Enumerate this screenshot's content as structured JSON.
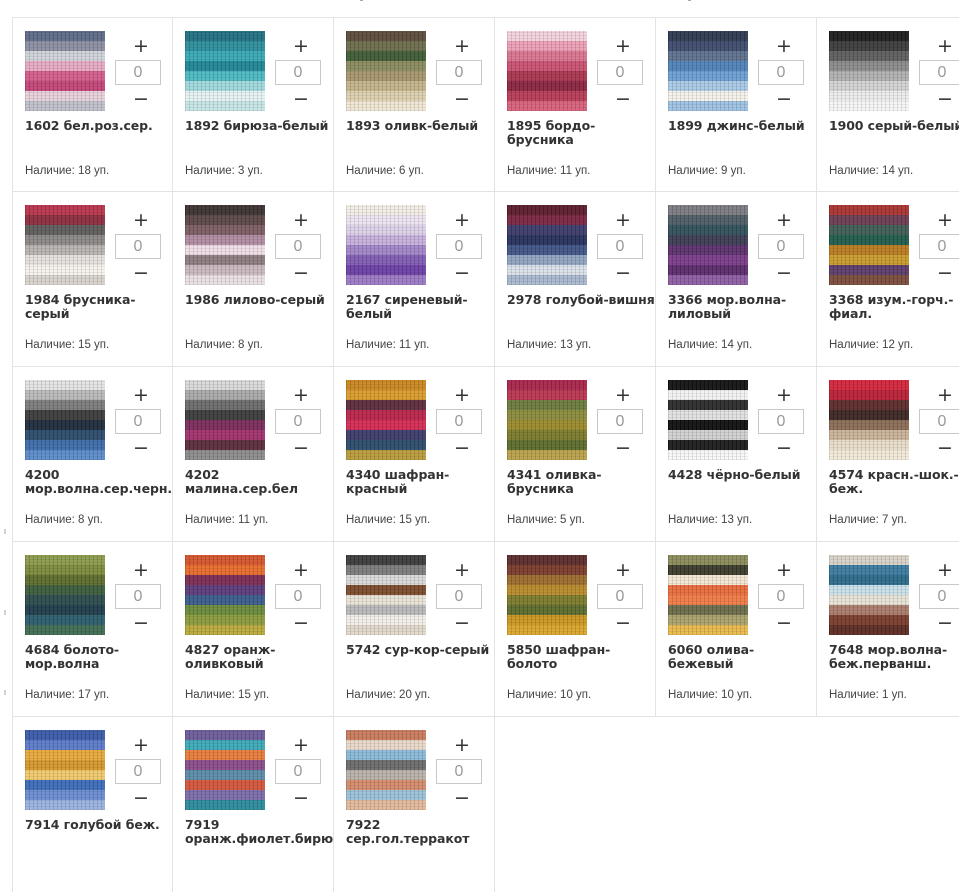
{
  "stock_prefix": "Наличие:",
  "stock_unit": "уп.",
  "controls": {
    "plus": "+",
    "minus": "−"
  },
  "products": [
    {
      "name": "1602 бел.роз.сер.",
      "qty": "0",
      "stock": 18,
      "colors": [
        "#5c6a85",
        "#8a8ea0",
        "#cfd2da",
        "#e6a9c3",
        "#d15a8a",
        "#c24478",
        "#e8cfd9",
        "#bdbec8"
      ]
    },
    {
      "name": "1892 бирюза-белый",
      "qty": "0",
      "stock": 3,
      "colors": [
        "#1f6f82",
        "#2a8d9c",
        "#36a8b4",
        "#1e8595",
        "#4bb8c2",
        "#9fd8dc",
        "#e6f2f2",
        "#c6e4e6"
      ]
    },
    {
      "name": "1893 оливк-белый",
      "qty": "0",
      "stock": 6,
      "colors": [
        "#5a4a3a",
        "#6a6b4a",
        "#3e5a33",
        "#8a8a5e",
        "#a5956b",
        "#c4b38a",
        "#dccfae",
        "#efe6d3"
      ]
    },
    {
      "name": "1895 бордо-брусника",
      "qty": "0",
      "stock": 11,
      "colors": [
        "#f2d2dc",
        "#ec9db4",
        "#d9728e",
        "#c9506f",
        "#a8344f",
        "#8a2440",
        "#b73a55",
        "#d75f7b"
      ]
    },
    {
      "name": "1899 джинс-белый",
      "qty": "0",
      "stock": 9,
      "colors": [
        "#2d3850",
        "#3c4a6a",
        "#5d6f8d",
        "#4f82b8",
        "#6b9ed1",
        "#a9c8e6",
        "#f4f2ea",
        "#9ec0e2"
      ]
    },
    {
      "name": "1900 серый-белый",
      "qty": "0",
      "stock": 14,
      "colors": [
        "#1c1c1c",
        "#3a3a3a",
        "#5c5c5c",
        "#8a8a8a",
        "#b0b0b0",
        "#d2d2d2",
        "#ececec",
        "#f6f6f6"
      ]
    },
    {
      "name": "1984 брусника-серый",
      "qty": "0",
      "stock": 15,
      "colors": [
        "#b8334c",
        "#8c2b3d",
        "#5e5a5a",
        "#8a8686",
        "#b8b3b0",
        "#e4e0dc",
        "#f5f2ee",
        "#d8d2cc"
      ]
    },
    {
      "name": "1986 лилово-серый",
      "qty": "0",
      "stock": 8,
      "colors": [
        "#3a3030",
        "#5a4545",
        "#7a5a62",
        "#b08aa0",
        "#f0dde6",
        "#8c7a7e",
        "#c9b8bd",
        "#e9dfe2"
      ]
    },
    {
      "name": "2167 сиреневый-белый",
      "qty": "0",
      "stock": 11,
      "colors": [
        "#f2eee6",
        "#ece3ef",
        "#ddd0e8",
        "#c6b0dc",
        "#a184c8",
        "#7f5bb2",
        "#6a3ea4",
        "#9a78c4"
      ]
    },
    {
      "name": "2978 голубой-вишня",
      "qty": "0",
      "stock": 13,
      "colors": [
        "#5a1a2a",
        "#7a2440",
        "#3a3a6a",
        "#26305a",
        "#3e5484",
        "#8fa2c0",
        "#d9e0e8",
        "#a7b7cc"
      ]
    },
    {
      "name": "3366 мор.волна-лиловый",
      "qty": "0",
      "stock": 14,
      "colors": [
        "#7a7a82",
        "#4e5a64",
        "#2e4f58",
        "#3a3a52",
        "#5a2f6a",
        "#7a3a8a",
        "#5a2a6a",
        "#8c5aa2"
      ]
    },
    {
      "name": "3368 изум.-горч.-фиал.",
      "qty": "0",
      "stock": 12,
      "colors": [
        "#a8322f",
        "#6a3a52",
        "#3e5a52",
        "#1e5a4a",
        "#b87a1e",
        "#c9992a",
        "#5a3a6a",
        "#7a4a3a"
      ]
    },
    {
      "name": "4200 мор.волна.сер.черн.",
      "qty": "0",
      "stock": 8,
      "colors": [
        "#e2e2e2",
        "#b8b8b8",
        "#7a7a7a",
        "#3a3a3a",
        "#1e2a3a",
        "#2a4a6a",
        "#3a6aa8",
        "#5a8ac8"
      ]
    },
    {
      "name": "4202 малина.сер.бел",
      "qty": "0",
      "stock": 11,
      "colors": [
        "#d8d8d8",
        "#a8a8a8",
        "#6a6a6a",
        "#3a3a3a",
        "#7a2a5a",
        "#a0306a",
        "#5a2a3a",
        "#8a8a8a"
      ]
    },
    {
      "name": "4340 шафран-красный",
      "qty": "0",
      "stock": 15,
      "colors": [
        "#c9851e",
        "#d99a2a",
        "#5a2a3a",
        "#b8234a",
        "#d42a52",
        "#3a3a6a",
        "#2a4a6a",
        "#b89a3a"
      ]
    },
    {
      "name": "4341 оливка-брусника",
      "qty": "0",
      "stock": 5,
      "colors": [
        "#a8234a",
        "#b8344e",
        "#6a7a3a",
        "#8a8a3a",
        "#9a8a2a",
        "#7a7a2a",
        "#5a6a2a",
        "#b8a04a"
      ]
    },
    {
      "name": "4428 чёрно-белый",
      "qty": "0",
      "stock": 13,
      "colors": [
        "#111111",
        "#f2f2f2",
        "#2a2a2a",
        "#e0e0e0",
        "#0e0e0e",
        "#cfcfcf",
        "#1a1a1a",
        "#f8f8f8"
      ]
    },
    {
      "name": "4574 красн.-шок.-беж.",
      "qty": "0",
      "stock": 7,
      "colors": [
        "#d4233a",
        "#b81e34",
        "#5a2a2a",
        "#3a2420",
        "#8a6a55",
        "#c8b298",
        "#e8dcc8",
        "#f2ead8"
      ]
    },
    {
      "name": "4684 болото-мор.волна",
      "qty": "0",
      "stock": 17,
      "colors": [
        "#8a9a4a",
        "#7a8a3a",
        "#5a6a2a",
        "#3a5a3a",
        "#2a4a4a",
        "#1e3a4a",
        "#2a5a6a",
        "#3e6a52"
      ]
    },
    {
      "name": "4827 оранж-оливковый",
      "qty": "0",
      "stock": 15,
      "colors": [
        "#d4542a",
        "#e86a2a",
        "#7a2a52",
        "#5a3a7a",
        "#3a5a8a",
        "#6a8a3a",
        "#8a9a3a",
        "#b8a83a"
      ]
    },
    {
      "name": "5742 сур-кор-серый",
      "qty": "0",
      "stock": 20,
      "colors": [
        "#3a3a3a",
        "#7a7a7a",
        "#d8d8d8",
        "#7a4a2a",
        "#e9e2d6",
        "#b8b8b8",
        "#f2efe8",
        "#e0d8ca"
      ]
    },
    {
      "name": "5850 шафран-болото",
      "qty": "0",
      "stock": 10,
      "colors": [
        "#5a2a2a",
        "#7a3a2a",
        "#9a6a2a",
        "#b88a2a",
        "#7a7a2a",
        "#5a6a2a",
        "#c9951e",
        "#d9a52a"
      ]
    },
    {
      "name": "6060 олива-бежевый",
      "qty": "0",
      "stock": 10,
      "colors": [
        "#8a8a5a",
        "#3a3a2a",
        "#f2e6d2",
        "#e86a3a",
        "#f07a45",
        "#6a6a4a",
        "#a8a06a",
        "#e8b84a"
      ]
    },
    {
      "name": "7648 мор.волна-беж.перванш.",
      "qty": "0",
      "stock": 1,
      "colors": [
        "#d8d2c8",
        "#3a7aa0",
        "#2a6a8a",
        "#c9e0ea",
        "#e8e2d6",
        "#a87a6a",
        "#7a3a2a",
        "#5a2a22"
      ]
    },
    {
      "name": "7914 голубой беж.",
      "qty": "0",
      "stock": null,
      "colors": [
        "#3a5aa8",
        "#5a7ac8",
        "#e8a83a",
        "#d4962a",
        "#f0c86a",
        "#3a6ab8",
        "#6a8ad0",
        "#9ab2e0"
      ]
    },
    {
      "name": "7919 оранж.фиолет.бирюза",
      "qty": "0",
      "stock": null,
      "colors": [
        "#6a5a9a",
        "#3aa8b8",
        "#e87a3a",
        "#8a4a8a",
        "#5a8aa8",
        "#d4543a",
        "#7a6aaa",
        "#2a8a9a"
      ]
    },
    {
      "name": "7922 сер.гол.терракот",
      "qty": "0",
      "stock": null,
      "colors": [
        "#c87a5a",
        "#e8d8c8",
        "#8ab8d8",
        "#6a6a6a",
        "#b8b0a8",
        "#d48a6a",
        "#9ac0d8",
        "#e2b89a"
      ]
    }
  ]
}
